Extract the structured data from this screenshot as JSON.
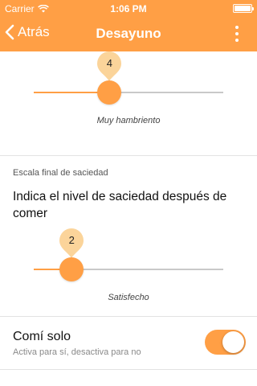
{
  "status_bar": {
    "carrier": "Carrier",
    "time": "1:06 PM"
  },
  "nav": {
    "back_label": "Atrás",
    "title": "Desayuno"
  },
  "hunger_slider": {
    "value": 4,
    "min": 0,
    "max": 10,
    "caption": "Muy hambriento"
  },
  "satiety_section": {
    "label": "Escala final de saciedad",
    "question": "Indica el nivel de saciedad después de comer",
    "slider": {
      "value": 2,
      "min": 0,
      "max": 10,
      "caption": "Satisfecho"
    }
  },
  "ate_alone": {
    "title": "Comí solo",
    "subtitle": "Activa para sí, desactiva para no",
    "checked": true
  },
  "colors": {
    "accent": "#ff9f45",
    "track_inactive": "#c9c9c9",
    "bubble": "#fbd49a"
  },
  "icons": {
    "back": "chevron-left-icon",
    "more": "vertical-dots-icon",
    "wifi": "wifi-icon",
    "battery": "battery-icon"
  }
}
